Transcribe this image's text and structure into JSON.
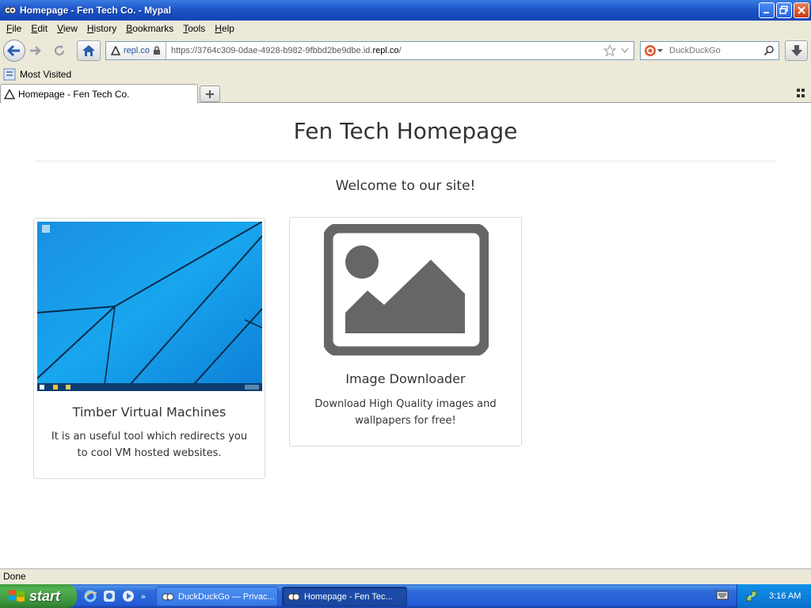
{
  "window": {
    "title": "Homepage - Fen Tech Co. - Mypal"
  },
  "menu": [
    "File",
    "Edit",
    "View",
    "History",
    "Bookmarks",
    "Tools",
    "Help"
  ],
  "navbar": {
    "identity_label": "repl.co",
    "url_prefix": "https://3764c309-0dae-4928-b982-9fbbd2be9dbe.id.",
    "url_host": "repl.co",
    "url_suffix": "/",
    "search_placeholder": "DuckDuckGo"
  },
  "bookmarks": {
    "most_visited": "Most Visited"
  },
  "tabs": [
    {
      "label": "Homepage - Fen Tech Co."
    }
  ],
  "page": {
    "heading": "Fen Tech Homepage",
    "welcome": "Welcome to our site!",
    "cards": [
      {
        "title": "Timber Virtual Machines",
        "text": "It is an useful tool which redirects you to cool VM hosted websites."
      },
      {
        "title": "Image Downloader",
        "text": "Download High Quality images and wallpapers for free!"
      }
    ]
  },
  "status": {
    "text": "Done"
  },
  "taskbar": {
    "start_label": "start",
    "tasks": [
      {
        "label": "DuckDuckGo — Privac..."
      },
      {
        "label": "Homepage - Fen Tec..."
      }
    ],
    "clock": "3:16 AM"
  },
  "colors": {
    "xp_blue": "#245dd7",
    "start_green": "#3a8f3a",
    "text_dark": "#333333"
  }
}
